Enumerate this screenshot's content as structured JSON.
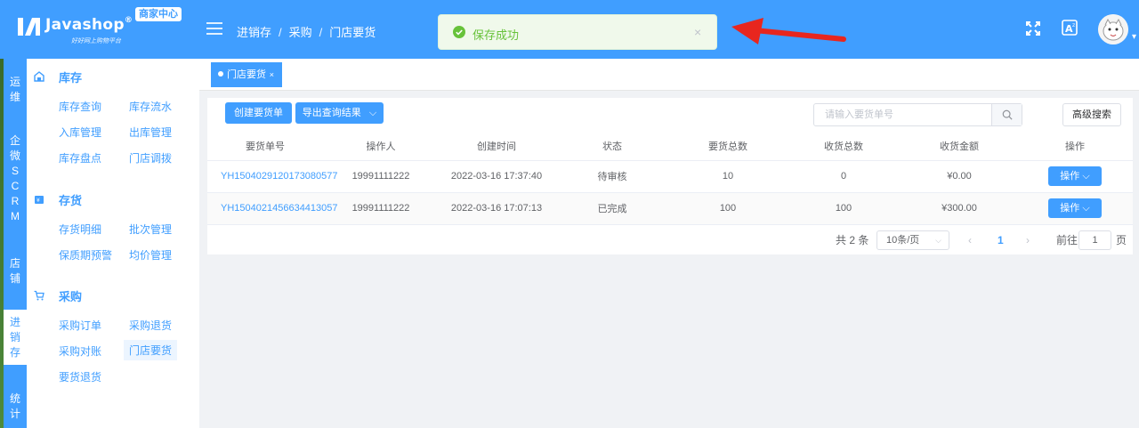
{
  "header": {
    "brand": "Javashop",
    "reg": "®",
    "slogan": "好好网上购物平台",
    "badge": "商家中心",
    "breadcrumb": [
      "进销存",
      "采购",
      "门店要货"
    ],
    "accent_color": "#409eff"
  },
  "toast": {
    "text": "保存成功",
    "close": "×",
    "color": "#67c23a"
  },
  "strip": [
    "运维",
    "企微SCRM",
    "店铺",
    "进销存",
    "统计"
  ],
  "sidebar": {
    "groups": [
      {
        "title": "库存",
        "icon": "warehouse-icon",
        "items": [
          "库存查询",
          "库存流水",
          "入库管理",
          "出库管理",
          "库存盘点",
          "门店调拨"
        ]
      },
      {
        "title": "存货",
        "icon": "inventory-icon",
        "items": [
          "存货明细",
          "批次管理",
          "保质期预警",
          "均价管理"
        ]
      },
      {
        "title": "采购",
        "icon": "cart-icon",
        "items": [
          "采购订单",
          "采购退货",
          "采购对账",
          "门店要货",
          "要货退货"
        ]
      }
    ],
    "active_item": "门店要货"
  },
  "tabs": [
    {
      "label": "门店要货",
      "close": "×"
    }
  ],
  "toolbar": {
    "create": "创建要货单",
    "export": "导出查询结果",
    "search_placeholder": "请输入要货单号",
    "advanced": "高级搜索"
  },
  "table": {
    "columns": [
      "要货单号",
      "操作人",
      "创建时间",
      "状态",
      "要货总数",
      "收货总数",
      "收货金额",
      "操作"
    ],
    "rows": [
      {
        "sn": "YH1504029120173080577",
        "operator": "19991111222",
        "time": "2022-03-16 17:37:40",
        "status": "待审核",
        "req_total": "10",
        "recv_total": "0",
        "amount": "¥0.00",
        "action": "操作"
      },
      {
        "sn": "YH1504021456634413057",
        "operator": "19991111222",
        "time": "2022-03-16 17:07:13",
        "status": "已完成",
        "req_total": "100",
        "recv_total": "100",
        "amount": "¥300.00",
        "action": "操作"
      }
    ]
  },
  "pagination": {
    "total": "共 2 条",
    "page_size": "10条/页",
    "current": "1",
    "goto_prefix": "前往",
    "goto_value": "1",
    "goto_suffix": "页"
  }
}
